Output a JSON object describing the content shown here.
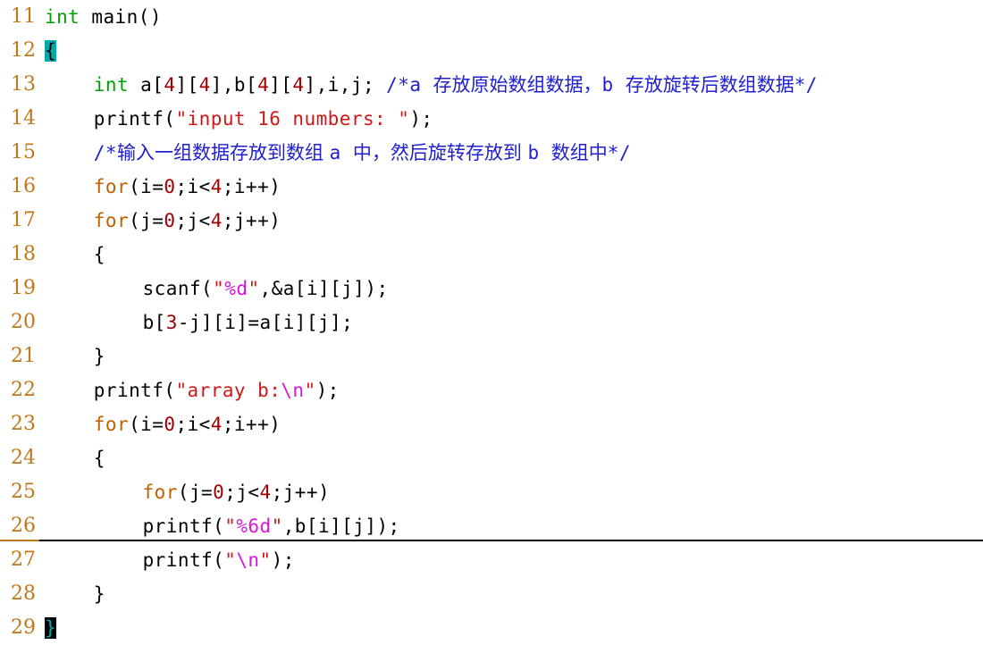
{
  "editor": {
    "background_color": "#ffffff",
    "gutter_color": "#c07818",
    "brace_highlight_color": "#00a8a8",
    "cursor_color": "#000000",
    "first_line_number": 11,
    "last_line_number": 29
  },
  "lines": [
    {
      "number": "11",
      "indent": 0,
      "tokens": [
        {
          "text": "int",
          "style": "type"
        },
        {
          "text": " main()",
          "style": "plain"
        }
      ]
    },
    {
      "number": "12",
      "indent": 0,
      "tokens": [
        {
          "text": "{",
          "style": "brace-match"
        }
      ]
    },
    {
      "number": "13",
      "indent": 4,
      "tokens": [
        {
          "text": "int",
          "style": "type"
        },
        {
          "text": " a[",
          "style": "plain"
        },
        {
          "text": "4",
          "style": "number"
        },
        {
          "text": "][",
          "style": "plain"
        },
        {
          "text": "4",
          "style": "number"
        },
        {
          "text": "],b[",
          "style": "plain"
        },
        {
          "text": "4",
          "style": "number"
        },
        {
          "text": "][",
          "style": "plain"
        },
        {
          "text": "4",
          "style": "number"
        },
        {
          "text": "],i,j; ",
          "style": "plain"
        },
        {
          "text": "/*a ",
          "style": "comment"
        },
        {
          "text": "存放原始数组数据，",
          "style": "comment-cjk"
        },
        {
          "text": "b ",
          "style": "comment"
        },
        {
          "text": "存放旋转后数组数据",
          "style": "comment-cjk"
        },
        {
          "text": "*/",
          "style": "comment"
        }
      ]
    },
    {
      "number": "14",
      "indent": 4,
      "tokens": [
        {
          "text": "printf(",
          "style": "plain"
        },
        {
          "text": "\"input 16 numbers: \"",
          "style": "string"
        },
        {
          "text": ");",
          "style": "plain"
        }
      ]
    },
    {
      "number": "15",
      "indent": 4,
      "tokens": [
        {
          "text": "/*",
          "style": "comment"
        },
        {
          "text": "输入一组数据存放到数组 ",
          "style": "comment-cjk"
        },
        {
          "text": "a ",
          "style": "comment"
        },
        {
          "text": "中，然后旋转存放到 ",
          "style": "comment-cjk"
        },
        {
          "text": "b ",
          "style": "comment"
        },
        {
          "text": "数组中",
          "style": "comment-cjk"
        },
        {
          "text": "*/",
          "style": "comment"
        }
      ]
    },
    {
      "number": "16",
      "indent": 4,
      "tokens": [
        {
          "text": "for",
          "style": "keyword"
        },
        {
          "text": "(i=",
          "style": "plain"
        },
        {
          "text": "0",
          "style": "number"
        },
        {
          "text": ";i<",
          "style": "plain"
        },
        {
          "text": "4",
          "style": "number"
        },
        {
          "text": ";i++)",
          "style": "plain"
        }
      ]
    },
    {
      "number": "17",
      "indent": 4,
      "tokens": [
        {
          "text": "for",
          "style": "keyword"
        },
        {
          "text": "(j=",
          "style": "plain"
        },
        {
          "text": "0",
          "style": "number"
        },
        {
          "text": ";j<",
          "style": "plain"
        },
        {
          "text": "4",
          "style": "number"
        },
        {
          "text": ";j++)",
          "style": "plain"
        }
      ]
    },
    {
      "number": "18",
      "indent": 4,
      "tokens": [
        {
          "text": "{",
          "style": "plain"
        }
      ]
    },
    {
      "number": "19",
      "indent": 8,
      "tokens": [
        {
          "text": "scanf(",
          "style": "plain"
        },
        {
          "text": "\"",
          "style": "string"
        },
        {
          "text": "%d",
          "style": "escape"
        },
        {
          "text": "\"",
          "style": "string"
        },
        {
          "text": ",&a[i][j]);",
          "style": "plain"
        }
      ]
    },
    {
      "number": "20",
      "indent": 8,
      "tokens": [
        {
          "text": "b[",
          "style": "plain"
        },
        {
          "text": "3",
          "style": "number"
        },
        {
          "text": "-j][i]=a[i][j];",
          "style": "plain"
        }
      ]
    },
    {
      "number": "21",
      "indent": 4,
      "tokens": [
        {
          "text": "}",
          "style": "plain"
        }
      ]
    },
    {
      "number": "22",
      "indent": 4,
      "tokens": [
        {
          "text": "printf(",
          "style": "plain"
        },
        {
          "text": "\"array b:",
          "style": "string"
        },
        {
          "text": "\\n",
          "style": "escape"
        },
        {
          "text": "\"",
          "style": "string"
        },
        {
          "text": ");",
          "style": "plain"
        }
      ]
    },
    {
      "number": "23",
      "indent": 4,
      "tokens": [
        {
          "text": "for",
          "style": "keyword"
        },
        {
          "text": "(i=",
          "style": "plain"
        },
        {
          "text": "0",
          "style": "number"
        },
        {
          "text": ";i<",
          "style": "plain"
        },
        {
          "text": "4",
          "style": "number"
        },
        {
          "text": ";i++)",
          "style": "plain"
        }
      ]
    },
    {
      "number": "24",
      "indent": 4,
      "tokens": [
        {
          "text": "{",
          "style": "plain"
        }
      ]
    },
    {
      "number": "25",
      "indent": 8,
      "tokens": [
        {
          "text": "for",
          "style": "keyword"
        },
        {
          "text": "(j=",
          "style": "plain"
        },
        {
          "text": "0",
          "style": "number"
        },
        {
          "text": ";j<",
          "style": "plain"
        },
        {
          "text": "4",
          "style": "number"
        },
        {
          "text": ";j++)",
          "style": "plain"
        }
      ]
    },
    {
      "number": "26",
      "indent": 8,
      "tokens": [
        {
          "text": "printf(",
          "style": "plain"
        },
        {
          "text": "\"",
          "style": "string"
        },
        {
          "text": "%6d",
          "style": "escape"
        },
        {
          "text": "\"",
          "style": "string"
        },
        {
          "text": ",b[i][j]);",
          "style": "plain"
        }
      ]
    },
    {
      "number": "27",
      "indent": 8,
      "tokens": [
        {
          "text": "printf(",
          "style": "plain"
        },
        {
          "text": "\"",
          "style": "string"
        },
        {
          "text": "\\n",
          "style": "escape"
        },
        {
          "text": "\"",
          "style": "string"
        },
        {
          "text": ");",
          "style": "plain"
        }
      ]
    },
    {
      "number": "28",
      "indent": 4,
      "tokens": [
        {
          "text": "}",
          "style": "plain"
        }
      ]
    },
    {
      "number": "29",
      "indent": 0,
      "tokens": [
        {
          "text": "}",
          "style": "cursor-block"
        }
      ]
    }
  ]
}
